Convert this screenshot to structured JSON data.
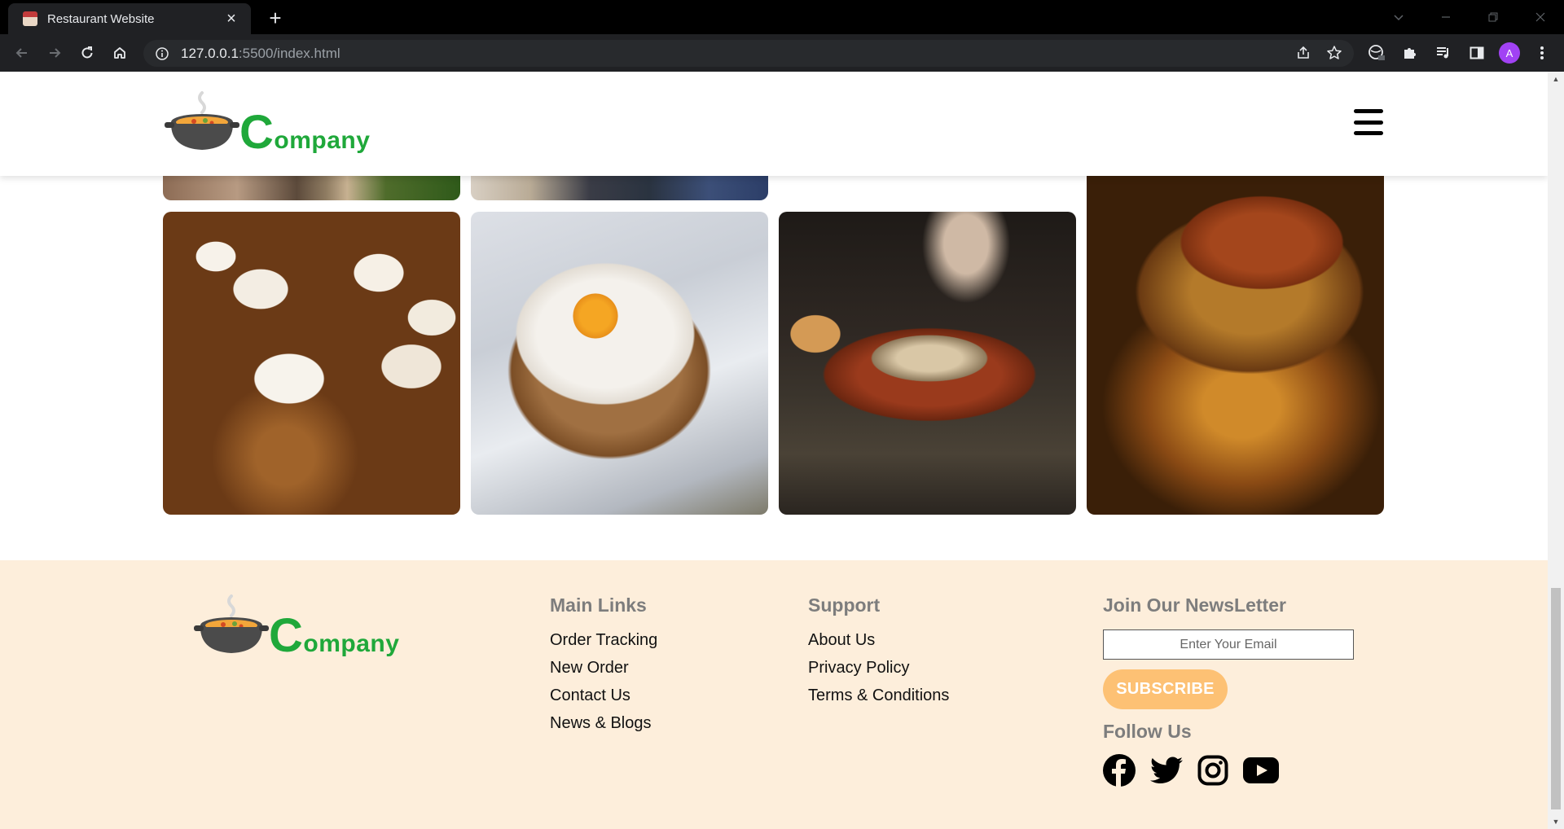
{
  "browser": {
    "tab_title": "Restaurant Website",
    "tab_close": "×",
    "new_tab": "+",
    "url_host": "127.0.0.1",
    "url_rest": ":5500/index.html",
    "profile_initial": "A"
  },
  "header": {
    "logo_initial": "C",
    "logo_rest": "ompany"
  },
  "footer": {
    "logo_initial": "C",
    "logo_rest": "ompany",
    "main_links": {
      "heading": "Main Links",
      "items": [
        "Order Tracking",
        "New Order",
        "Contact Us",
        "News & Blogs"
      ]
    },
    "support": {
      "heading": "Support",
      "items": [
        "About Us",
        "Privacy Policy",
        "Terms & Conditions"
      ]
    },
    "newsletter": {
      "heading": "Join Our NewsLetter",
      "email_placeholder": "Enter Your Email",
      "subscribe_label": "SUBSCRIBE"
    },
    "follow": {
      "heading": "Follow Us",
      "icons": [
        "facebook-icon",
        "twitter-icon",
        "instagram-icon",
        "youtube-icon"
      ]
    }
  },
  "colors": {
    "brand_green": "#1fa83a",
    "footer_bg": "#fdeedb",
    "subscribe_bg": "#fdc174"
  }
}
